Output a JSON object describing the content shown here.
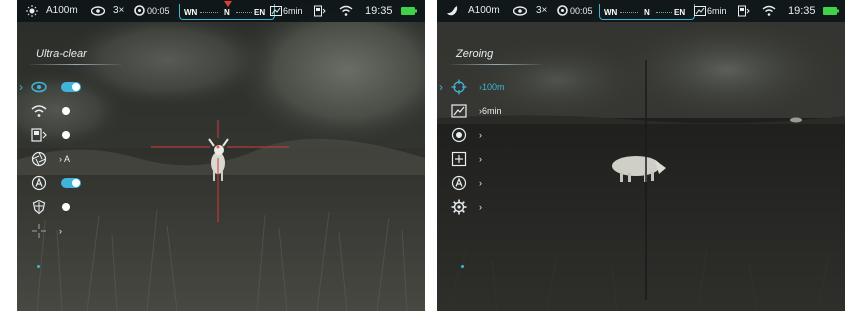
{
  "colors": {
    "accent": "#3fb4d8",
    "reticle": "#d23a3a",
    "battery": "#3fd24a",
    "text": "#e8eef0"
  },
  "left_screen": {
    "status": {
      "mode_icon": "sun-icon",
      "range": "A100m",
      "zoom": "3×",
      "timer": "00:05",
      "compass_labels": [
        "WN",
        "N",
        "EN"
      ],
      "recording": "6min",
      "time": "19:35"
    },
    "menu": {
      "title": "Ultra-clear",
      "items": [
        {
          "icon": "eye-icon",
          "kind": "toggle",
          "state": "on",
          "selected": true
        },
        {
          "icon": "wifi-icon",
          "kind": "toggle",
          "state": "off"
        },
        {
          "icon": "display-icon",
          "kind": "toggle",
          "state": "off"
        },
        {
          "icon": "aperture-icon",
          "kind": "value",
          "value": "A"
        },
        {
          "icon": "a-circle-icon",
          "kind": "toggle",
          "state": "on"
        },
        {
          "icon": "shield-icon",
          "kind": "toggle",
          "state": "off"
        },
        {
          "icon": "crosshair-icon",
          "kind": "value",
          "value": ""
        }
      ]
    }
  },
  "right_screen": {
    "status": {
      "mode_icon": "moon-icon",
      "range": "A100m",
      "zoom": "3×",
      "timer": "00:05",
      "compass_labels": [
        "WN",
        "N",
        "EN"
      ],
      "recording": "6min",
      "time": "19:35"
    },
    "menu": {
      "title": "Zeroing",
      "items": [
        {
          "icon": "crosshair-target-icon",
          "kind": "value",
          "value": "100m",
          "selected": true
        },
        {
          "icon": "picture-icon",
          "kind": "value",
          "value": "6min"
        },
        {
          "icon": "dot-circle-icon",
          "kind": "value",
          "value": ""
        },
        {
          "icon": "plus-square-icon",
          "kind": "value",
          "value": ""
        },
        {
          "icon": "a-circle-icon",
          "kind": "value",
          "value": ""
        },
        {
          "icon": "gear-icon",
          "kind": "value",
          "value": ""
        }
      ]
    }
  }
}
